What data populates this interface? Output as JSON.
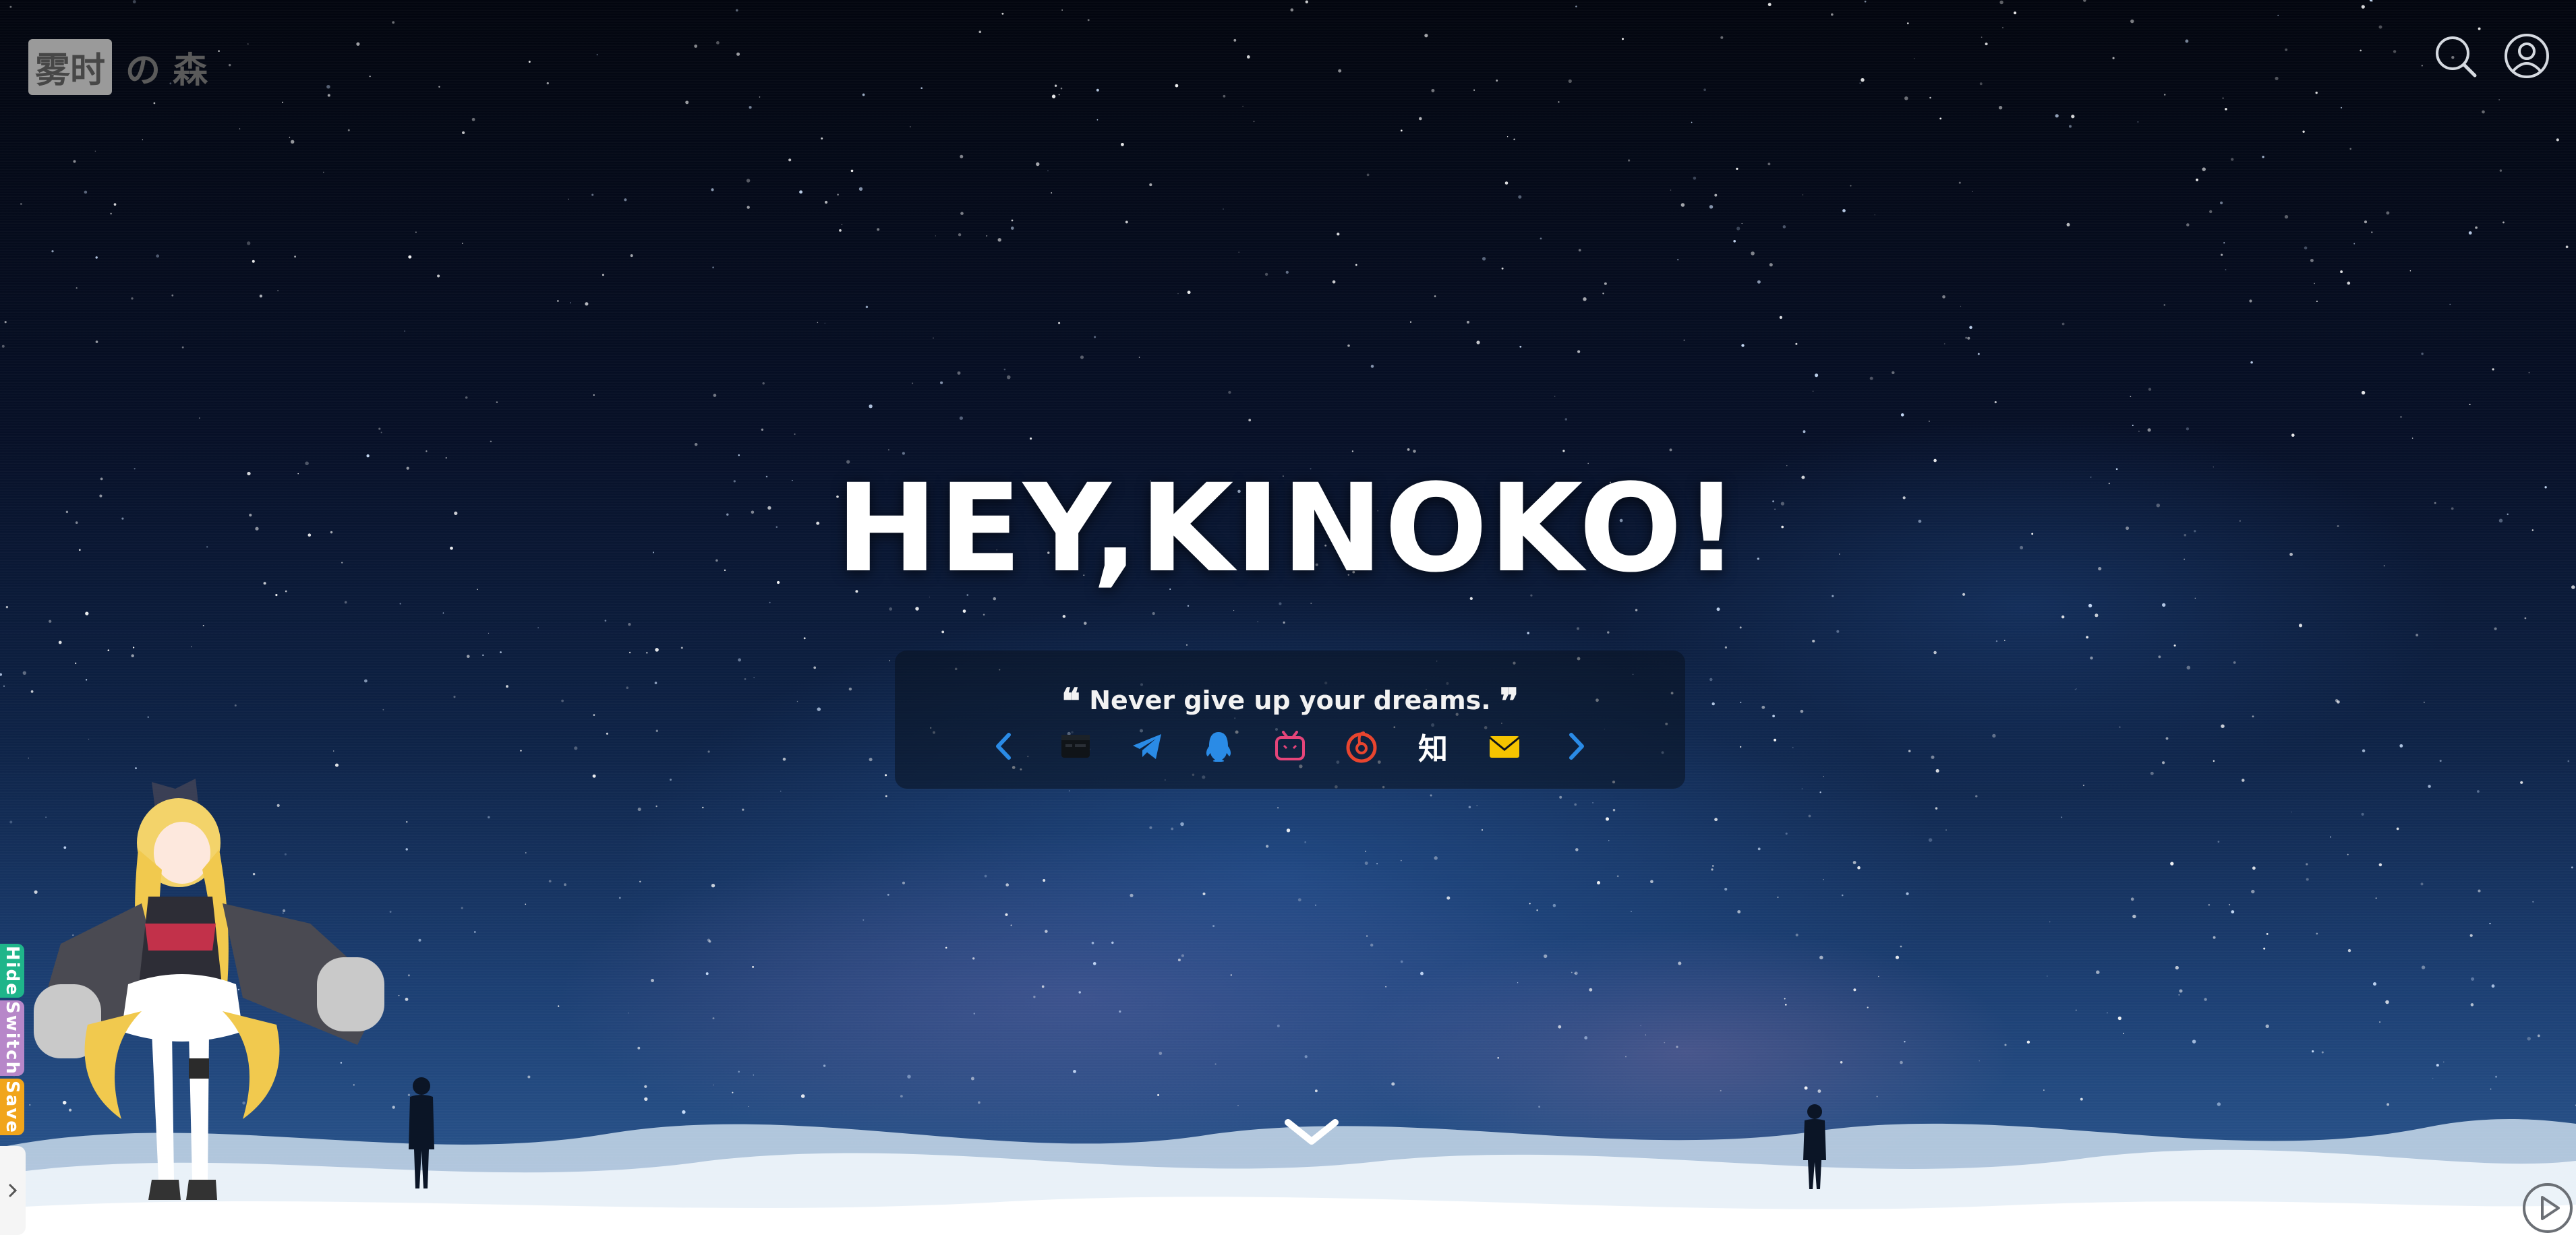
{
  "site": {
    "logo_boxed": "雾时",
    "logo_rest": "の 森"
  },
  "header": {
    "search_icon": "search-icon",
    "user_icon": "user-icon"
  },
  "hero": {
    "title": "HEY,KINOKO!",
    "quote_open": "❝",
    "quote": "Never give up your dreams.",
    "quote_close": "❞"
  },
  "social": {
    "prev_icon": "chevron-left-icon",
    "next_icon": "chevron-right-icon",
    "items": [
      "github-icon",
      "telegram-icon",
      "qq-icon",
      "bilibili-icon",
      "netease-music-icon",
      "zhihu-icon",
      "email-icon"
    ],
    "zhihu_label": "知"
  },
  "widgets": {
    "hide": "Hide",
    "switch": "Switch",
    "save": "Save"
  },
  "colors": {
    "accent_blue": "#2a8be6",
    "hide_tab": "#1fb58a",
    "switch_tab": "#b787c9",
    "save_tab": "#f1a51b",
    "bilibili": "#e5457a",
    "netease": "#e8452f",
    "email": "#f5c400"
  }
}
